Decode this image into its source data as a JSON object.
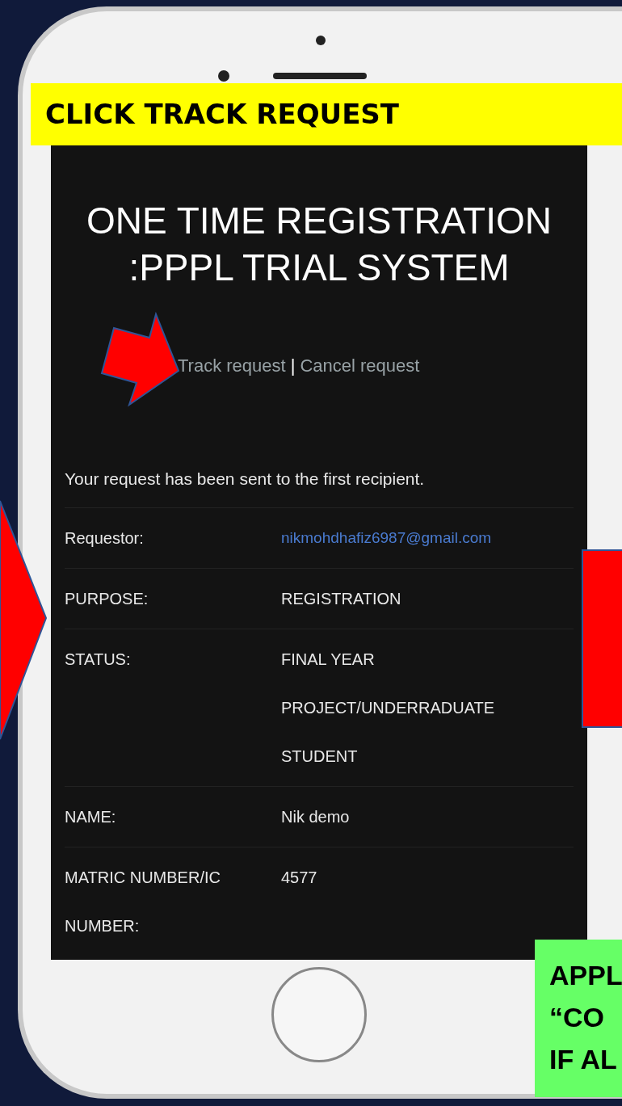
{
  "banner": {
    "text": "CLICK TRACK REQUEST"
  },
  "screen": {
    "title": "ONE TIME REGISTRATION :PPPL TRIAL SYSTEM",
    "links": [
      {
        "label": "Track request"
      },
      {
        "label": "Cancel request"
      }
    ],
    "separator": "|",
    "message": "Your request has been sent to the first recipient.",
    "rows": [
      {
        "label": "Requestor:",
        "value": "nikmohdhafiz6987@gmail.com",
        "kind": "link"
      },
      {
        "label": "PURPOSE:",
        "value": "REGISTRATION",
        "kind": "text"
      },
      {
        "label": "STATUS:",
        "value": "FINAL YEAR PROJECT/UNDERRADUATE STUDENT",
        "kind": "text"
      },
      {
        "label": "NAME:",
        "value": "Nik demo",
        "kind": "text"
      },
      {
        "label": "MATRIC NUMBER/IC NUMBER:",
        "value": "4577",
        "kind": "text"
      }
    ]
  },
  "note": {
    "lines": [
      "APPL",
      "“CO",
      "IF AL"
    ]
  }
}
